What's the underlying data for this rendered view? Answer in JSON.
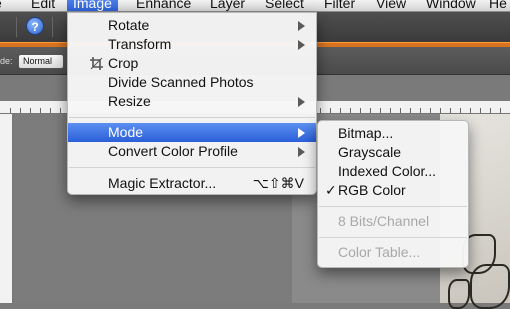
{
  "menubar": {
    "items": [
      {
        "label": "e"
      },
      {
        "label": "Edit"
      },
      {
        "label": "Image"
      },
      {
        "label": "Enhance"
      },
      {
        "label": "Layer"
      },
      {
        "label": "Select"
      },
      {
        "label": "Filter"
      },
      {
        "label": "View"
      },
      {
        "label": "Window"
      },
      {
        "label": "He"
      }
    ]
  },
  "toolbar": {
    "help_label": "?"
  },
  "options_bar": {
    "mode_label": "de:",
    "mode_value": "Normal"
  },
  "image_menu": {
    "items": [
      {
        "label": "Rotate"
      },
      {
        "label": "Transform"
      },
      {
        "label": "Crop"
      },
      {
        "label": "Divide Scanned Photos"
      },
      {
        "label": "Resize"
      },
      {
        "label": "Mode"
      },
      {
        "label": "Convert Color Profile"
      },
      {
        "label": "Magic Extractor...",
        "shortcut": "⌥⇧⌘V"
      }
    ]
  },
  "mode_submenu": {
    "items": [
      {
        "label": "Bitmap..."
      },
      {
        "label": "Grayscale"
      },
      {
        "label": "Indexed Color..."
      },
      {
        "label": "RGB Color",
        "check": "✓"
      },
      {
        "label": "8 Bits/Channel"
      },
      {
        "label": "Color Table..."
      }
    ]
  },
  "colors": {
    "highlight": "#2a5fd9",
    "accent_bar": "#d8741f",
    "toolbar": "#3b3b3b"
  }
}
